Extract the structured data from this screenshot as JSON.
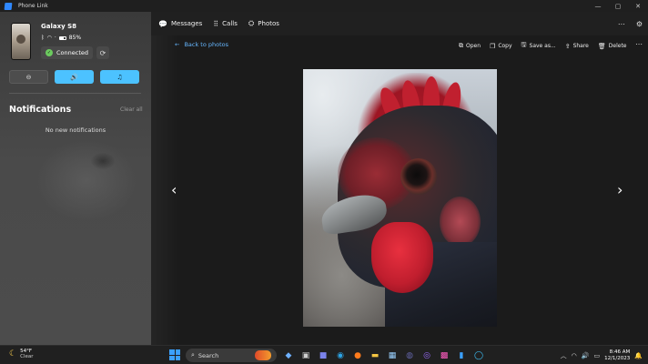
{
  "window": {
    "title": "Phone Link"
  },
  "window_controls": {
    "minimize": "—",
    "maximize": "▢",
    "close": "✕"
  },
  "device": {
    "name": "Galaxy S8",
    "battery": "85%",
    "status": "Connected"
  },
  "quick_actions": [
    {
      "icon": "do-not-disturb-icon",
      "glyph": "⊖",
      "state": "off"
    },
    {
      "icon": "volume-icon",
      "glyph": "🔊",
      "state": "on"
    },
    {
      "icon": "music-icon",
      "glyph": "♫",
      "state": "on"
    }
  ],
  "notifications": {
    "title": "Notifications",
    "clear_all": "Clear all",
    "empty_text": "No new notifications"
  },
  "nav": {
    "tabs": [
      {
        "label": "Messages",
        "icon": "messages-icon",
        "glyph": "💬"
      },
      {
        "label": "Calls",
        "icon": "calls-icon",
        "glyph": "⠿"
      },
      {
        "label": "Photos",
        "icon": "photos-icon",
        "glyph": "⛭"
      }
    ],
    "more": "⋯",
    "settings": "⚙"
  },
  "viewer": {
    "back_label": "Back to photos",
    "toolbar": [
      {
        "label": "Open",
        "icon": "open-icon",
        "glyph": "⧉"
      },
      {
        "label": "Copy",
        "icon": "copy-icon",
        "glyph": "❐"
      },
      {
        "label": "Save as...",
        "icon": "save-icon",
        "glyph": "🖫"
      },
      {
        "label": "Share",
        "icon": "share-icon",
        "glyph": "⇪"
      },
      {
        "label": "Delete",
        "icon": "delete-icon",
        "glyph": "🗑"
      }
    ],
    "more": "⋯",
    "prev": "‹",
    "next": "›"
  },
  "taskbar": {
    "weather": {
      "temp": "54°F",
      "condition": "Clear"
    },
    "search_label": "Search",
    "apps": [
      {
        "name": "copilot-app-icon",
        "glyph": "◆",
        "color": "#6fb1ff"
      },
      {
        "name": "file-explorer-app-icon",
        "glyph": "▣",
        "color": "#cfcfcf"
      },
      {
        "name": "teams-app-icon",
        "glyph": "■",
        "color": "#7b83eb"
      },
      {
        "name": "edge-app-icon",
        "glyph": "◉",
        "color": "#2ca4e6"
      },
      {
        "name": "firefox-app-icon",
        "glyph": "●",
        "color": "#ff7b1c"
      },
      {
        "name": "folder-app-icon",
        "glyph": "▬",
        "color": "#f5c542"
      },
      {
        "name": "store-app-icon",
        "glyph": "▦",
        "color": "#9ad1ff"
      },
      {
        "name": "teams-alt-app-icon",
        "glyph": "◍",
        "color": "#6264a7"
      },
      {
        "name": "messenger-app-icon",
        "glyph": "◎",
        "color": "#9b6cff"
      },
      {
        "name": "paint-app-icon",
        "glyph": "▩",
        "color": "#ff5cc0"
      },
      {
        "name": "phone-link-app-icon",
        "glyph": "▮",
        "color": "#3ba0ff"
      },
      {
        "name": "alexa-app-icon",
        "glyph": "◯",
        "color": "#3ec6ff"
      }
    ],
    "clock": {
      "time": "8:46 AM",
      "date": "12/1/2023"
    }
  },
  "colors": {
    "accent": "#4cc2ff",
    "link": "#66b7ff",
    "connected": "#6ccb5f"
  }
}
